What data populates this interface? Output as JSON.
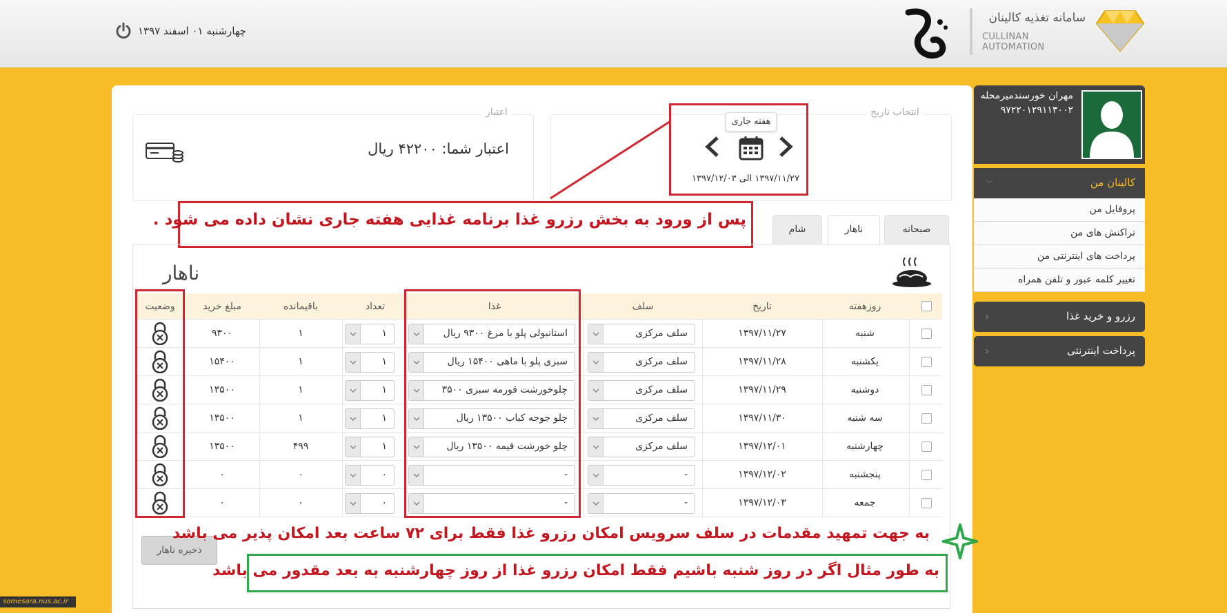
{
  "header": {
    "logo_fa": "سامانه تغذیه کالینان",
    "logo_en": "CULLINAN AUTOMATION",
    "date": "چهارشنبه ۰۱ اسفند ۱۳۹۷"
  },
  "sidebar": {
    "user_name": "مهران خورسندمیرمحله",
    "user_id": "۹۷۲۲۰۱۲۹۱۱۳۰۰۲",
    "menu_kalinan": "کالینان من",
    "items": [
      {
        "label": "پروفایل من"
      },
      {
        "label": "تراکنش های من"
      },
      {
        "label": "پرداخت های اینترنتی من"
      },
      {
        "label": "تغییر کلمه عبور و تلفن همراه"
      }
    ],
    "menu_reserve": "رزرو و خرید غذا",
    "menu_payment": "پرداخت اینترنتی"
  },
  "date_selector": {
    "title": "انتخاب تاریخ",
    "week_label": "هفته جاری",
    "range": "۱۳۹۷/۱۱/۲۷ الی ۱۳۹۷/۱۲/۰۳"
  },
  "credit": {
    "title": "اعتبار",
    "text": "اعتبار شما: ۴۲۲۰۰ ریال"
  },
  "tabs": [
    {
      "label": "صبحانه"
    },
    {
      "label": "ناهار"
    },
    {
      "label": "شام"
    }
  ],
  "section_title": "ناهار",
  "table": {
    "headers": {
      "day": "روزهفته",
      "date": "تاریخ",
      "self": "سلف",
      "food": "غذا",
      "count": "تعداد",
      "remaining": "باقیمانده",
      "amount": "مبلغ خرید",
      "status": "وضعیت"
    },
    "rows": [
      {
        "day": "شنبه",
        "date": "۱۳۹۷/۱۱/۲۷",
        "self": "سلف مرکزی",
        "food": "استانبولی پلو با مرغ ۹۳۰۰ ریال",
        "count": "۱",
        "remaining": "۱",
        "amount": "۹۳۰۰"
      },
      {
        "day": "یکشنبه",
        "date": "۱۳۹۷/۱۱/۲۸",
        "self": "سلف مرکزی",
        "food": "سبزی پلو با ماهی ۱۵۴۰۰ ریال",
        "count": "۱",
        "remaining": "۱",
        "amount": "۱۵۴۰۰"
      },
      {
        "day": "دوشنبه",
        "date": "۱۳۹۷/۱۱/۲۹",
        "self": "سلف مرکزی",
        "food": "چلوخورشت قورمه سبزی ۳۵۰۰",
        "count": "۱",
        "remaining": "۱",
        "amount": "۱۳۵۰۰"
      },
      {
        "day": "سه شنبه",
        "date": "۱۳۹۷/۱۱/۳۰",
        "self": "سلف مرکزی",
        "food": "چلو جوجه کباب ۱۳۵۰۰ ریال",
        "count": "۱",
        "remaining": "۱",
        "amount": "۱۳۵۰۰"
      },
      {
        "day": "چهارشنبه",
        "date": "۱۳۹۷/۱۲/۰۱",
        "self": "سلف مرکزی",
        "food": "چلو خورشت قیمه ۱۳۵۰۰ ریال",
        "count": "۱",
        "remaining": "۴۹۹",
        "amount": "۱۳۵۰۰"
      },
      {
        "day": "پنجشنبه",
        "date": "۱۳۹۷/۱۲/۰۲",
        "self": "-",
        "food": "-",
        "count": "۰",
        "remaining": "۰",
        "amount": "۰"
      },
      {
        "day": "جمعه",
        "date": "۱۳۹۷/۱۲/۰۳",
        "self": "-",
        "food": "-",
        "count": "۰",
        "remaining": "۰",
        "amount": "۰"
      }
    ]
  },
  "save_button": "ذخیره ناهار",
  "annotations": {
    "top": "پس از ورود به بخش رزرو غذا برنامه  غذایی هفته جاری نشان داده می شود  .",
    "bottom1": "به جهت تمهید مقدمات در سلف سرویس امکان رزرو    غذا فقط برای ۷۲ ساعت بعد امکان پذیر می باشد",
    "bottom2": "به طور مثال اگر در روز شنبه باشیم  فقط امکان رزرو غذا از روز چهارشنبه به بعد مقدور می باشد"
  },
  "watermark": "somesara.nus.ac.ir",
  "colors": {
    "background": "#f6bd27",
    "annotation_red": "#d0262f",
    "annotation_green": "#2ea84a",
    "sidebar_dark": "#444444"
  }
}
